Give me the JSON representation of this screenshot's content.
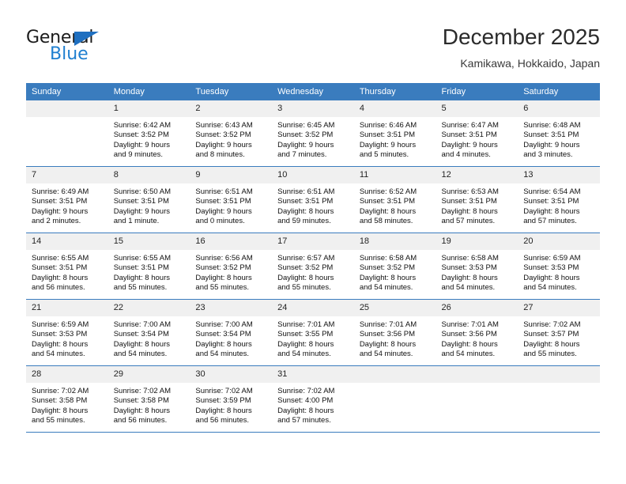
{
  "brand": {
    "name_top": "General",
    "name_bottom": "Blue",
    "accent_color": "#1f7fd0",
    "triangle_color": "#1f6fc0"
  },
  "header": {
    "title": "December 2025",
    "subtitle": "Kamikawa, Hokkaido, Japan"
  },
  "calendar": {
    "header_background": "#3a7cbe",
    "daynum_background": "#f0f0f0",
    "weekday_headers": [
      "Sunday",
      "Monday",
      "Tuesday",
      "Wednesday",
      "Thursday",
      "Friday",
      "Saturday"
    ],
    "weeks": [
      [
        {
          "day": "",
          "lines": []
        },
        {
          "day": "1",
          "lines": [
            "Sunrise: 6:42 AM",
            "Sunset: 3:52 PM",
            "Daylight: 9 hours",
            "and 9 minutes."
          ]
        },
        {
          "day": "2",
          "lines": [
            "Sunrise: 6:43 AM",
            "Sunset: 3:52 PM",
            "Daylight: 9 hours",
            "and 8 minutes."
          ]
        },
        {
          "day": "3",
          "lines": [
            "Sunrise: 6:45 AM",
            "Sunset: 3:52 PM",
            "Daylight: 9 hours",
            "and 7 minutes."
          ]
        },
        {
          "day": "4",
          "lines": [
            "Sunrise: 6:46 AM",
            "Sunset: 3:51 PM",
            "Daylight: 9 hours",
            "and 5 minutes."
          ]
        },
        {
          "day": "5",
          "lines": [
            "Sunrise: 6:47 AM",
            "Sunset: 3:51 PM",
            "Daylight: 9 hours",
            "and 4 minutes."
          ]
        },
        {
          "day": "6",
          "lines": [
            "Sunrise: 6:48 AM",
            "Sunset: 3:51 PM",
            "Daylight: 9 hours",
            "and 3 minutes."
          ]
        }
      ],
      [
        {
          "day": "7",
          "lines": [
            "Sunrise: 6:49 AM",
            "Sunset: 3:51 PM",
            "Daylight: 9 hours",
            "and 2 minutes."
          ]
        },
        {
          "day": "8",
          "lines": [
            "Sunrise: 6:50 AM",
            "Sunset: 3:51 PM",
            "Daylight: 9 hours",
            "and 1 minute."
          ]
        },
        {
          "day": "9",
          "lines": [
            "Sunrise: 6:51 AM",
            "Sunset: 3:51 PM",
            "Daylight: 9 hours",
            "and 0 minutes."
          ]
        },
        {
          "day": "10",
          "lines": [
            "Sunrise: 6:51 AM",
            "Sunset: 3:51 PM",
            "Daylight: 8 hours",
            "and 59 minutes."
          ]
        },
        {
          "day": "11",
          "lines": [
            "Sunrise: 6:52 AM",
            "Sunset: 3:51 PM",
            "Daylight: 8 hours",
            "and 58 minutes."
          ]
        },
        {
          "day": "12",
          "lines": [
            "Sunrise: 6:53 AM",
            "Sunset: 3:51 PM",
            "Daylight: 8 hours",
            "and 57 minutes."
          ]
        },
        {
          "day": "13",
          "lines": [
            "Sunrise: 6:54 AM",
            "Sunset: 3:51 PM",
            "Daylight: 8 hours",
            "and 57 minutes."
          ]
        }
      ],
      [
        {
          "day": "14",
          "lines": [
            "Sunrise: 6:55 AM",
            "Sunset: 3:51 PM",
            "Daylight: 8 hours",
            "and 56 minutes."
          ]
        },
        {
          "day": "15",
          "lines": [
            "Sunrise: 6:55 AM",
            "Sunset: 3:51 PM",
            "Daylight: 8 hours",
            "and 55 minutes."
          ]
        },
        {
          "day": "16",
          "lines": [
            "Sunrise: 6:56 AM",
            "Sunset: 3:52 PM",
            "Daylight: 8 hours",
            "and 55 minutes."
          ]
        },
        {
          "day": "17",
          "lines": [
            "Sunrise: 6:57 AM",
            "Sunset: 3:52 PM",
            "Daylight: 8 hours",
            "and 55 minutes."
          ]
        },
        {
          "day": "18",
          "lines": [
            "Sunrise: 6:58 AM",
            "Sunset: 3:52 PM",
            "Daylight: 8 hours",
            "and 54 minutes."
          ]
        },
        {
          "day": "19",
          "lines": [
            "Sunrise: 6:58 AM",
            "Sunset: 3:53 PM",
            "Daylight: 8 hours",
            "and 54 minutes."
          ]
        },
        {
          "day": "20",
          "lines": [
            "Sunrise: 6:59 AM",
            "Sunset: 3:53 PM",
            "Daylight: 8 hours",
            "and 54 minutes."
          ]
        }
      ],
      [
        {
          "day": "21",
          "lines": [
            "Sunrise: 6:59 AM",
            "Sunset: 3:53 PM",
            "Daylight: 8 hours",
            "and 54 minutes."
          ]
        },
        {
          "day": "22",
          "lines": [
            "Sunrise: 7:00 AM",
            "Sunset: 3:54 PM",
            "Daylight: 8 hours",
            "and 54 minutes."
          ]
        },
        {
          "day": "23",
          "lines": [
            "Sunrise: 7:00 AM",
            "Sunset: 3:54 PM",
            "Daylight: 8 hours",
            "and 54 minutes."
          ]
        },
        {
          "day": "24",
          "lines": [
            "Sunrise: 7:01 AM",
            "Sunset: 3:55 PM",
            "Daylight: 8 hours",
            "and 54 minutes."
          ]
        },
        {
          "day": "25",
          "lines": [
            "Sunrise: 7:01 AM",
            "Sunset: 3:56 PM",
            "Daylight: 8 hours",
            "and 54 minutes."
          ]
        },
        {
          "day": "26",
          "lines": [
            "Sunrise: 7:01 AM",
            "Sunset: 3:56 PM",
            "Daylight: 8 hours",
            "and 54 minutes."
          ]
        },
        {
          "day": "27",
          "lines": [
            "Sunrise: 7:02 AM",
            "Sunset: 3:57 PM",
            "Daylight: 8 hours",
            "and 55 minutes."
          ]
        }
      ],
      [
        {
          "day": "28",
          "lines": [
            "Sunrise: 7:02 AM",
            "Sunset: 3:58 PM",
            "Daylight: 8 hours",
            "and 55 minutes."
          ]
        },
        {
          "day": "29",
          "lines": [
            "Sunrise: 7:02 AM",
            "Sunset: 3:58 PM",
            "Daylight: 8 hours",
            "and 56 minutes."
          ]
        },
        {
          "day": "30",
          "lines": [
            "Sunrise: 7:02 AM",
            "Sunset: 3:59 PM",
            "Daylight: 8 hours",
            "and 56 minutes."
          ]
        },
        {
          "day": "31",
          "lines": [
            "Sunrise: 7:02 AM",
            "Sunset: 4:00 PM",
            "Daylight: 8 hours",
            "and 57 minutes."
          ]
        },
        {
          "day": "",
          "lines": []
        },
        {
          "day": "",
          "lines": []
        },
        {
          "day": "",
          "lines": []
        }
      ]
    ]
  }
}
